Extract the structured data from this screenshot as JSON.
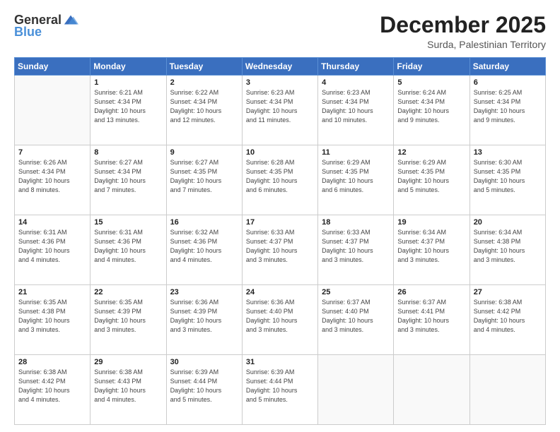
{
  "logo": {
    "general": "General",
    "blue": "Blue"
  },
  "title": "December 2025",
  "subtitle": "Surda, Palestinian Territory",
  "days_of_week": [
    "Sunday",
    "Monday",
    "Tuesday",
    "Wednesday",
    "Thursday",
    "Friday",
    "Saturday"
  ],
  "weeks": [
    [
      {
        "day": "",
        "info": ""
      },
      {
        "day": "1",
        "info": "Sunrise: 6:21 AM\nSunset: 4:34 PM\nDaylight: 10 hours\nand 13 minutes."
      },
      {
        "day": "2",
        "info": "Sunrise: 6:22 AM\nSunset: 4:34 PM\nDaylight: 10 hours\nand 12 minutes."
      },
      {
        "day": "3",
        "info": "Sunrise: 6:23 AM\nSunset: 4:34 PM\nDaylight: 10 hours\nand 11 minutes."
      },
      {
        "day": "4",
        "info": "Sunrise: 6:23 AM\nSunset: 4:34 PM\nDaylight: 10 hours\nand 10 minutes."
      },
      {
        "day": "5",
        "info": "Sunrise: 6:24 AM\nSunset: 4:34 PM\nDaylight: 10 hours\nand 9 minutes."
      },
      {
        "day": "6",
        "info": "Sunrise: 6:25 AM\nSunset: 4:34 PM\nDaylight: 10 hours\nand 9 minutes."
      }
    ],
    [
      {
        "day": "7",
        "info": "Sunrise: 6:26 AM\nSunset: 4:34 PM\nDaylight: 10 hours\nand 8 minutes."
      },
      {
        "day": "8",
        "info": "Sunrise: 6:27 AM\nSunset: 4:34 PM\nDaylight: 10 hours\nand 7 minutes."
      },
      {
        "day": "9",
        "info": "Sunrise: 6:27 AM\nSunset: 4:35 PM\nDaylight: 10 hours\nand 7 minutes."
      },
      {
        "day": "10",
        "info": "Sunrise: 6:28 AM\nSunset: 4:35 PM\nDaylight: 10 hours\nand 6 minutes."
      },
      {
        "day": "11",
        "info": "Sunrise: 6:29 AM\nSunset: 4:35 PM\nDaylight: 10 hours\nand 6 minutes."
      },
      {
        "day": "12",
        "info": "Sunrise: 6:29 AM\nSunset: 4:35 PM\nDaylight: 10 hours\nand 5 minutes."
      },
      {
        "day": "13",
        "info": "Sunrise: 6:30 AM\nSunset: 4:35 PM\nDaylight: 10 hours\nand 5 minutes."
      }
    ],
    [
      {
        "day": "14",
        "info": "Sunrise: 6:31 AM\nSunset: 4:36 PM\nDaylight: 10 hours\nand 4 minutes."
      },
      {
        "day": "15",
        "info": "Sunrise: 6:31 AM\nSunset: 4:36 PM\nDaylight: 10 hours\nand 4 minutes."
      },
      {
        "day": "16",
        "info": "Sunrise: 6:32 AM\nSunset: 4:36 PM\nDaylight: 10 hours\nand 4 minutes."
      },
      {
        "day": "17",
        "info": "Sunrise: 6:33 AM\nSunset: 4:37 PM\nDaylight: 10 hours\nand 3 minutes."
      },
      {
        "day": "18",
        "info": "Sunrise: 6:33 AM\nSunset: 4:37 PM\nDaylight: 10 hours\nand 3 minutes."
      },
      {
        "day": "19",
        "info": "Sunrise: 6:34 AM\nSunset: 4:37 PM\nDaylight: 10 hours\nand 3 minutes."
      },
      {
        "day": "20",
        "info": "Sunrise: 6:34 AM\nSunset: 4:38 PM\nDaylight: 10 hours\nand 3 minutes."
      }
    ],
    [
      {
        "day": "21",
        "info": "Sunrise: 6:35 AM\nSunset: 4:38 PM\nDaylight: 10 hours\nand 3 minutes."
      },
      {
        "day": "22",
        "info": "Sunrise: 6:35 AM\nSunset: 4:39 PM\nDaylight: 10 hours\nand 3 minutes."
      },
      {
        "day": "23",
        "info": "Sunrise: 6:36 AM\nSunset: 4:39 PM\nDaylight: 10 hours\nand 3 minutes."
      },
      {
        "day": "24",
        "info": "Sunrise: 6:36 AM\nSunset: 4:40 PM\nDaylight: 10 hours\nand 3 minutes."
      },
      {
        "day": "25",
        "info": "Sunrise: 6:37 AM\nSunset: 4:40 PM\nDaylight: 10 hours\nand 3 minutes."
      },
      {
        "day": "26",
        "info": "Sunrise: 6:37 AM\nSunset: 4:41 PM\nDaylight: 10 hours\nand 3 minutes."
      },
      {
        "day": "27",
        "info": "Sunrise: 6:38 AM\nSunset: 4:42 PM\nDaylight: 10 hours\nand 4 minutes."
      }
    ],
    [
      {
        "day": "28",
        "info": "Sunrise: 6:38 AM\nSunset: 4:42 PM\nDaylight: 10 hours\nand 4 minutes."
      },
      {
        "day": "29",
        "info": "Sunrise: 6:38 AM\nSunset: 4:43 PM\nDaylight: 10 hours\nand 4 minutes."
      },
      {
        "day": "30",
        "info": "Sunrise: 6:39 AM\nSunset: 4:44 PM\nDaylight: 10 hours\nand 5 minutes."
      },
      {
        "day": "31",
        "info": "Sunrise: 6:39 AM\nSunset: 4:44 PM\nDaylight: 10 hours\nand 5 minutes."
      },
      {
        "day": "",
        "info": ""
      },
      {
        "day": "",
        "info": ""
      },
      {
        "day": "",
        "info": ""
      }
    ]
  ]
}
